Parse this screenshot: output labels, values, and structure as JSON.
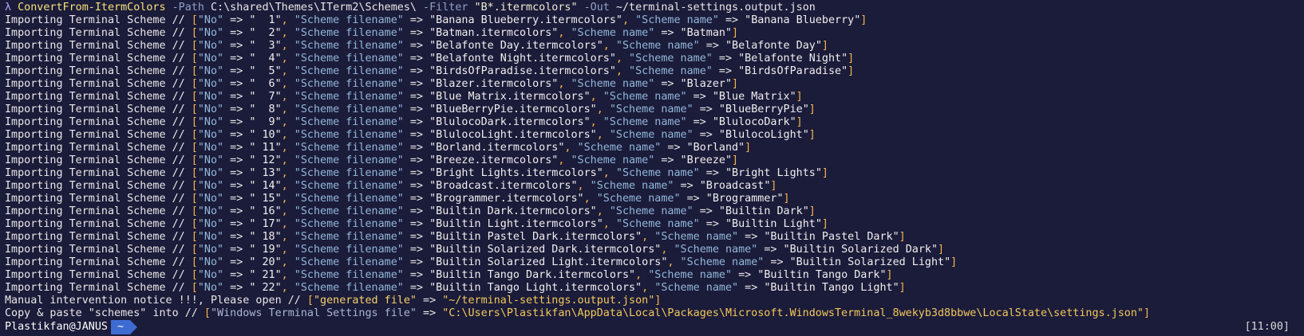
{
  "command": {
    "prompt_symbol": "λ",
    "cmdlet": "ConvertFrom-ItermColors",
    "path_flag": "-Path",
    "path_value": "C:\\shared\\Themes\\ITerm2\\Schemes\\",
    "filter_flag": "-Filter",
    "filter_value": "\"B*.itermcolors\"",
    "out_flag": "-Out",
    "out_value": "~/terminal-settings.output.json"
  },
  "top_timestamp": "[11:00]",
  "import_prefix": "Importing Terminal Scheme //",
  "imports": [
    {
      "no": "  1",
      "file": "Banana Blueberry.itermcolors",
      "name": "Banana Blueberry"
    },
    {
      "no": "  2",
      "file": "Batman.itermcolors",
      "name": "Batman"
    },
    {
      "no": "  3",
      "file": "Belafonte Day.itermcolors",
      "name": "Belafonte Day"
    },
    {
      "no": "  4",
      "file": "Belafonte Night.itermcolors",
      "name": "Belafonte Night"
    },
    {
      "no": "  5",
      "file": "BirdsOfParadise.itermcolors",
      "name": "BirdsOfParadise"
    },
    {
      "no": "  6",
      "file": "Blazer.itermcolors",
      "name": "Blazer"
    },
    {
      "no": "  7",
      "file": "Blue Matrix.itermcolors",
      "name": "Blue Matrix"
    },
    {
      "no": "  8",
      "file": "BlueBerryPie.itermcolors",
      "name": "BlueBerryPie"
    },
    {
      "no": "  9",
      "file": "BlulocoDark.itermcolors",
      "name": "BlulocoDark"
    },
    {
      "no": " 10",
      "file": "BlulocoLight.itermcolors",
      "name": "BlulocoLight"
    },
    {
      "no": " 11",
      "file": "Borland.itermcolors",
      "name": "Borland"
    },
    {
      "no": " 12",
      "file": "Breeze.itermcolors",
      "name": "Breeze"
    },
    {
      "no": " 13",
      "file": "Bright Lights.itermcolors",
      "name": "Bright Lights"
    },
    {
      "no": " 14",
      "file": "Broadcast.itermcolors",
      "name": "Broadcast"
    },
    {
      "no": " 15",
      "file": "Brogrammer.itermcolors",
      "name": "Brogrammer"
    },
    {
      "no": " 16",
      "file": "Builtin Dark.itermcolors",
      "name": "Builtin Dark"
    },
    {
      "no": " 17",
      "file": "Builtin Light.itermcolors",
      "name": "Builtin Light"
    },
    {
      "no": " 18",
      "file": "Builtin Pastel Dark.itermcolors",
      "name": "Builtin Pastel Dark"
    },
    {
      "no": " 19",
      "file": "Builtin Solarized Dark.itermcolors",
      "name": "Builtin Solarized Dark"
    },
    {
      "no": " 20",
      "file": "Builtin Solarized Light.itermcolors",
      "name": "Builtin Solarized Light"
    },
    {
      "no": " 21",
      "file": "Builtin Tango Dark.itermcolors",
      "name": "Builtin Tango Dark"
    },
    {
      "no": " 22",
      "file": "Builtin Tango Light.itermcolors",
      "name": "Builtin Tango Light"
    }
  ],
  "keys": {
    "no": "\"No\"",
    "file": "\"Scheme filename\"",
    "name": "\"Scheme name\"",
    "arrow": "=>"
  },
  "notice": {
    "text": "Manual intervention notice !!!, Please open //",
    "key": "\"generated file\"",
    "value": "\"~/terminal-settings.output.json\""
  },
  "copy": {
    "text": "Copy & paste \"schemes\" into //",
    "key": "\"Windows Terminal Settings file\"",
    "value": "\"C:\\Users\\Plastikfan\\AppData\\Local\\Packages\\Microsoft.WindowsTerminal_8wekyb3d8bbwe\\LocalState\\settings.json\""
  },
  "prompt": {
    "user_host": "Plastikfan@JANUS",
    "dir": "~",
    "time": "[11:00]"
  },
  "colors": {
    "background": "#1b1b3a",
    "dir_badge": "#3e6bd2",
    "bracket": "#f6b64a",
    "key": "#93b9d9"
  }
}
